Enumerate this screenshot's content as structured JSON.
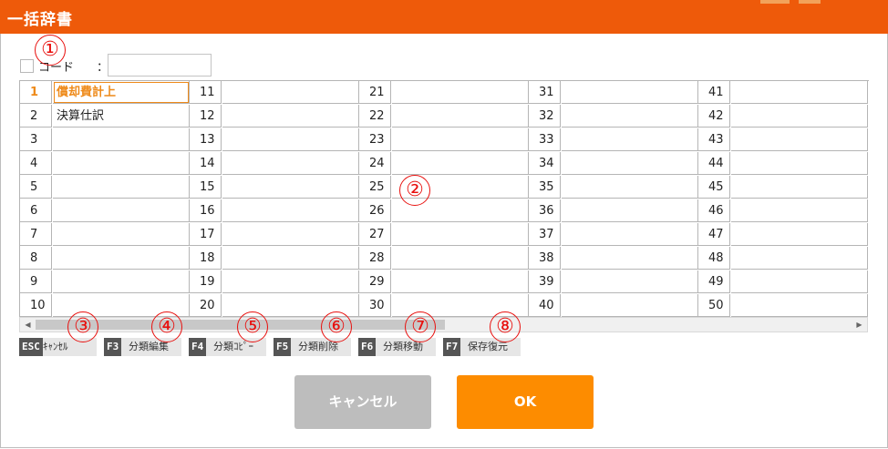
{
  "window": {
    "title": "一括辞書"
  },
  "markers": [
    "①",
    "②",
    "③",
    "④",
    "⑤",
    "⑥",
    "⑦",
    "⑧"
  ],
  "code_filter": {
    "label": "コード",
    "colon": "：",
    "value": "",
    "checked": false
  },
  "columns": [
    {
      "rows": [
        {
          "num": "1",
          "name": "償却費計上"
        },
        {
          "num": "2",
          "name": "決算仕訳"
        },
        {
          "num": "3",
          "name": ""
        },
        {
          "num": "4",
          "name": ""
        },
        {
          "num": "5",
          "name": ""
        },
        {
          "num": "6",
          "name": ""
        },
        {
          "num": "7",
          "name": ""
        },
        {
          "num": "8",
          "name": ""
        },
        {
          "num": "9",
          "name": ""
        },
        {
          "num": "10",
          "name": ""
        }
      ]
    },
    {
      "rows": [
        {
          "num": "11",
          "name": ""
        },
        {
          "num": "12",
          "name": ""
        },
        {
          "num": "13",
          "name": ""
        },
        {
          "num": "14",
          "name": ""
        },
        {
          "num": "15",
          "name": ""
        },
        {
          "num": "16",
          "name": ""
        },
        {
          "num": "17",
          "name": ""
        },
        {
          "num": "18",
          "name": ""
        },
        {
          "num": "19",
          "name": ""
        },
        {
          "num": "20",
          "name": ""
        }
      ]
    },
    {
      "rows": [
        {
          "num": "21",
          "name": ""
        },
        {
          "num": "22",
          "name": ""
        },
        {
          "num": "23",
          "name": ""
        },
        {
          "num": "24",
          "name": ""
        },
        {
          "num": "25",
          "name": ""
        },
        {
          "num": "26",
          "name": ""
        },
        {
          "num": "27",
          "name": ""
        },
        {
          "num": "28",
          "name": ""
        },
        {
          "num": "29",
          "name": ""
        },
        {
          "num": "30",
          "name": ""
        }
      ]
    },
    {
      "rows": [
        {
          "num": "31",
          "name": ""
        },
        {
          "num": "32",
          "name": ""
        },
        {
          "num": "33",
          "name": ""
        },
        {
          "num": "34",
          "name": ""
        },
        {
          "num": "35",
          "name": ""
        },
        {
          "num": "36",
          "name": ""
        },
        {
          "num": "37",
          "name": ""
        },
        {
          "num": "38",
          "name": ""
        },
        {
          "num": "39",
          "name": ""
        },
        {
          "num": "40",
          "name": ""
        }
      ]
    },
    {
      "rows": [
        {
          "num": "41",
          "name": ""
        },
        {
          "num": "42",
          "name": ""
        },
        {
          "num": "43",
          "name": ""
        },
        {
          "num": "44",
          "name": ""
        },
        {
          "num": "45",
          "name": ""
        },
        {
          "num": "46",
          "name": ""
        },
        {
          "num": "47",
          "name": ""
        },
        {
          "num": "48",
          "name": ""
        },
        {
          "num": "49",
          "name": ""
        },
        {
          "num": "50",
          "name": ""
        }
      ]
    }
  ],
  "active_row": "1",
  "function_keys": [
    {
      "key": "ESC",
      "label": "ｷｬﾝｾﾙ"
    },
    {
      "key": "F3",
      "label": "分類編集"
    },
    {
      "key": "F4",
      "label": "分類ｺﾋﾟｰ"
    },
    {
      "key": "F5",
      "label": "分類削除"
    },
    {
      "key": "F6",
      "label": "分類移動"
    },
    {
      "key": "F7",
      "label": "保存復元"
    }
  ],
  "buttons": {
    "cancel": "キャンセル",
    "ok": "OK"
  },
  "colors": {
    "title_bar": "#ee5a0a",
    "accent_orange": "#fd8c00",
    "marker_red": "#e8100e",
    "cancel_gray": "#bdbdbd"
  }
}
